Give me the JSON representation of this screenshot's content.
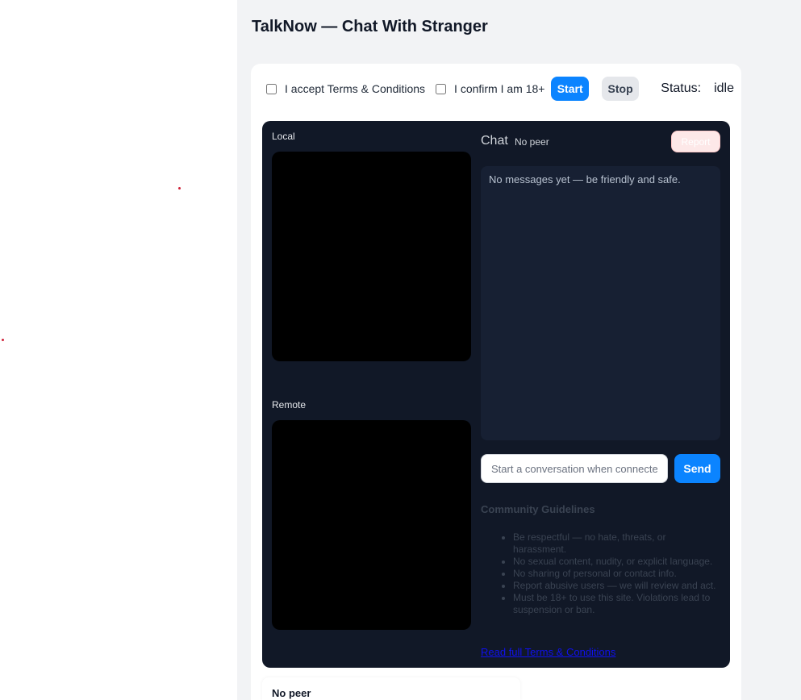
{
  "app": {
    "title": "TalkNow — Chat With Stranger"
  },
  "controls": {
    "accept_terms_label": "I accept Terms & Conditions",
    "confirm_age_label": "I confirm I am 18+",
    "start_label": "Start",
    "stop_label": "Stop",
    "status_label": "Status:",
    "status_value": "idle"
  },
  "video": {
    "local_label": "Local",
    "remote_label": "Remote"
  },
  "chat": {
    "title": "Chat",
    "peer_status": "No peer",
    "report_label": "Report",
    "empty_message": "No messages yet — be friendly and safe.",
    "input_placeholder": "Start a conversation when connected",
    "send_label": "Send"
  },
  "guidelines": {
    "title": "Community Guidelines",
    "items": [
      "Be respectful — no hate, threats, or harassment.",
      "No sexual content, nudity, or explicit language.",
      "No sharing of personal or contact info.",
      "Report abusive users — we will review and act.",
      "Must be 18+ to use this site. Violations lead to suspension or ban."
    ],
    "terms_link": "Read full Terms & Conditions"
  },
  "footer": {
    "peer_label": "No peer"
  },
  "colors": {
    "accent": "#0b84ff",
    "panel": "#111827",
    "status_dot": "#d0233a"
  }
}
